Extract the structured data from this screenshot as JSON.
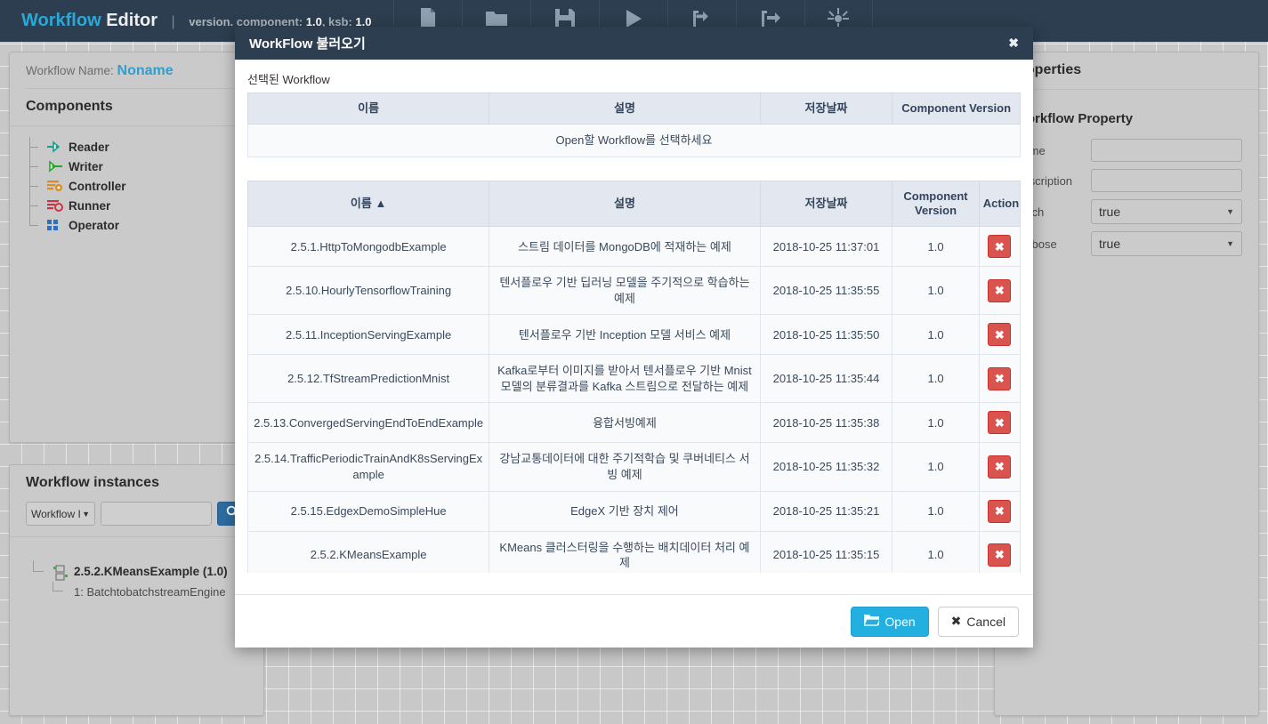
{
  "header": {
    "brand_primary": "Workflow",
    "brand_secondary": "Editor",
    "separator": "|",
    "version_text": "version. component:",
    "component_version": "1.0",
    "ksb_text": ", ksb:",
    "ksb_version": "1.0",
    "accent_color": "#2aa8d8",
    "bar_color": "#2d3e50",
    "toolbar": [
      {
        "name": "new-file-icon",
        "label": "New"
      },
      {
        "name": "open-folder-icon",
        "label": "Open"
      },
      {
        "name": "save-icon",
        "label": "Save"
      },
      {
        "name": "run-play-icon",
        "label": "Run"
      },
      {
        "name": "import-arrow-icon",
        "label": "Import"
      },
      {
        "name": "export-arrow-icon",
        "label": "Export"
      },
      {
        "name": "sparkle-magic-icon",
        "label": "Auto"
      }
    ]
  },
  "components_panel": {
    "workflow_name_label": "Workflow Name:",
    "workflow_name_value": "Noname",
    "title": "Components",
    "items": [
      {
        "label": "Reader",
        "icon": "reader-icon"
      },
      {
        "label": "Writer",
        "icon": "writer-icon"
      },
      {
        "label": "Controller",
        "icon": "controller-icon"
      },
      {
        "label": "Runner",
        "icon": "runner-icon"
      },
      {
        "label": "Operator",
        "icon": "operator-icon"
      }
    ]
  },
  "instances_panel": {
    "title": "Workflow instances",
    "filter_selected": "Workflow I",
    "search_value": "",
    "search_placeholder": "",
    "search_icon": "search-icon",
    "tree": {
      "root_label": "2.5.2.KMeansExample (1.0)",
      "child_label": "1: BatchtobatchstreamEngine"
    }
  },
  "properties_panel": {
    "title": "Properties",
    "section_title": "Workflow Property",
    "fields": [
      {
        "label": "Name",
        "type": "text",
        "value": ""
      },
      {
        "label": "Description",
        "type": "text",
        "value": ""
      },
      {
        "label": "Batch",
        "type": "select",
        "value": "true"
      },
      {
        "label": "Verbose",
        "type": "select",
        "value": "true"
      }
    ]
  },
  "modal": {
    "title": "WorkFlow 불러오기",
    "close_label": "✖",
    "selected_section_label": "선택된 Workflow",
    "selected_table": {
      "columns": [
        "이름",
        "설명",
        "저장날짜",
        "Component Version"
      ],
      "empty_message": "Open할 Workflow를 선택하세요"
    },
    "list_table": {
      "columns": [
        "이름 ▲",
        "설명",
        "저장날짜",
        "Component Version",
        "Action"
      ],
      "sort_column": "이름",
      "sort_direction": "asc",
      "delete_label": "✖",
      "rows": [
        {
          "name": "2.5.1.HttpToMongodbExample",
          "description": "스트림 데이터를 MongoDB에 적재하는 예제",
          "saved_at": "2018-10-25 11:37:01",
          "component_version": "1.0"
        },
        {
          "name": "2.5.10.HourlyTensorflowTraining",
          "description": "텐서플로우 기반 딥러닝 모델을 주기적으로 학습하는 예제",
          "saved_at": "2018-10-25 11:35:55",
          "component_version": "1.0"
        },
        {
          "name": "2.5.11.InceptionServingExample",
          "description": "텐서플로우 기반 Inception 모델 서비스 예제",
          "saved_at": "2018-10-25 11:35:50",
          "component_version": "1.0"
        },
        {
          "name": "2.5.12.TfStreamPredictionMnist",
          "description": "Kafka로부터 이미지를 받아서 텐서플로우 기반 Mnist 모델의 분류결과를 Kafka 스트림으로 전달하는 예제",
          "saved_at": "2018-10-25 11:35:44",
          "component_version": "1.0"
        },
        {
          "name": "2.5.13.ConvergedServingEndToEndExample",
          "description": "융합서빙예제",
          "saved_at": "2018-10-25 11:35:38",
          "component_version": "1.0"
        },
        {
          "name": "2.5.14.TrafficPeriodicTrainAndK8sServingExample",
          "description": "강남교통데이터에 대한 주기적학습 및 쿠버네티스 서빙 예제",
          "saved_at": "2018-10-25 11:35:32",
          "component_version": "1.0"
        },
        {
          "name": "2.5.15.EdgexDemoSimpleHue",
          "description": "EdgeX 기반 장치 제어",
          "saved_at": "2018-10-25 11:35:21",
          "component_version": "1.0"
        },
        {
          "name": "2.5.2.KMeansExample",
          "description": "KMeans 클러스터링을 수행하는 배치데이터 처리 예제",
          "saved_at": "2018-10-25 11:35:15",
          "component_version": "1.0"
        }
      ]
    },
    "footer": {
      "open_label": "Open",
      "open_icon": "folder-open-icon",
      "open_color": "#23b0e0",
      "cancel_label": "Cancel",
      "cancel_icon": "close-x-icon"
    }
  }
}
